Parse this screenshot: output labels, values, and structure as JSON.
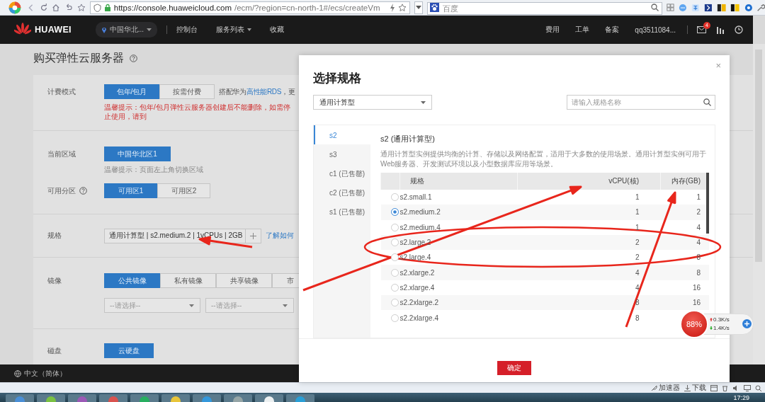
{
  "browser": {
    "url_host": "https://console.huaweicloud.com",
    "url_path": "/ecm/?region=cn-north-1#/ecs/createVm",
    "search_placeholder": "百度"
  },
  "top_nav": {
    "logo": "HUAWEI",
    "region": "中国华北...",
    "links": [
      {
        "label": "控制台",
        "dropdown": false
      },
      {
        "label": "服务列表",
        "dropdown": true
      },
      {
        "label": "收藏",
        "dropdown": false
      }
    ],
    "right_links": [
      "费用",
      "工单",
      "备案"
    ],
    "user": "qq3511084...",
    "mail_badge": "4"
  },
  "page": {
    "title": "购买弹性云服务器",
    "billing": {
      "label": "计费模式",
      "options": [
        {
          "label": "包年/包月",
          "selected": true
        },
        {
          "label": "按需付费",
          "selected": false
        }
      ],
      "note_prefix": "搭配华为",
      "note_link": "高性能RDS",
      "note_suffix": "，更",
      "warning": "温馨提示：包年/包月弹性云服务器创建后不能删除，如需停止使用，请到"
    },
    "region": {
      "label": "当前区域",
      "button": "中国华北区1",
      "hint": "温馨提示：页面左上角切换区域"
    },
    "zone": {
      "label": "可用分区",
      "options": [
        {
          "label": "可用区1",
          "selected": true
        },
        {
          "label": "可用区2",
          "selected": false
        }
      ]
    },
    "flavor": {
      "label": "规格",
      "value": "通用计算型 | s2.medium.2 | 1vCPUs | 2GB",
      "link": "了解如何"
    },
    "image": {
      "label": "镜像",
      "tabs": [
        {
          "label": "公共镜像",
          "selected": true
        },
        {
          "label": "私有镜像",
          "selected": false
        },
        {
          "label": "共享镜像",
          "selected": false
        },
        {
          "label": "市",
          "selected": false
        }
      ],
      "selects": [
        "--请选择--",
        "--请选择--"
      ]
    },
    "disk": {
      "label": "磁盘",
      "options": [
        {
          "label": "云硬盘",
          "selected": true
        }
      ]
    },
    "footer_language": "中文（简体）"
  },
  "dialog": {
    "title": "选择规格",
    "close": "×",
    "type_select": "通用计算型",
    "search_placeholder": "请输入规格名称",
    "families": [
      {
        "label": "s2",
        "selected": true
      },
      {
        "label": "s3",
        "selected": false
      },
      {
        "label": "c1 (已售罄)",
        "selected": false
      },
      {
        "label": "c2 (已售罄)",
        "selected": false
      },
      {
        "label": "s1 (已售罄)",
        "selected": false
      }
    ],
    "heading": "s2 (通用计算型)",
    "description": "通用计算型实例提供均衡的计算、存储以及网络配置，适用于大多数的使用场景。通用计算型实例可用于Web服务器、开发测试环境以及小型数据库应用等场景。",
    "columns": [
      "规格",
      "vCPU(核)",
      "内存(GB)"
    ],
    "rows": [
      {
        "name": "s2.small.1",
        "vcpu": "1",
        "memory": "1",
        "selected": false
      },
      {
        "name": "s2.medium.2",
        "vcpu": "1",
        "memory": "2",
        "selected": true
      },
      {
        "name": "s2.medium.4",
        "vcpu": "1",
        "memory": "4",
        "selected": false
      },
      {
        "name": "s2.large.2",
        "vcpu": "2",
        "memory": "4",
        "selected": false
      },
      {
        "name": "s2.large.4",
        "vcpu": "2",
        "memory": "8",
        "selected": false
      },
      {
        "name": "s2.xlarge.2",
        "vcpu": "4",
        "memory": "8",
        "selected": false
      },
      {
        "name": "s2.xlarge.4",
        "vcpu": "4",
        "memory": "16",
        "selected": false
      },
      {
        "name": "s2.2xlarge.2",
        "vcpu": "8",
        "memory": "16",
        "selected": false
      },
      {
        "name": "s2.2xlarge.4",
        "vcpu": "8",
        "selected": false
      }
    ],
    "confirm": "确定"
  },
  "widget": {
    "percent": "88%",
    "upload": "0.3K/s",
    "download": "1.4K/s"
  },
  "status_bar": {
    "items": [
      "加速器",
      "下载"
    ]
  },
  "taskbar": {
    "time": "17:29"
  }
}
